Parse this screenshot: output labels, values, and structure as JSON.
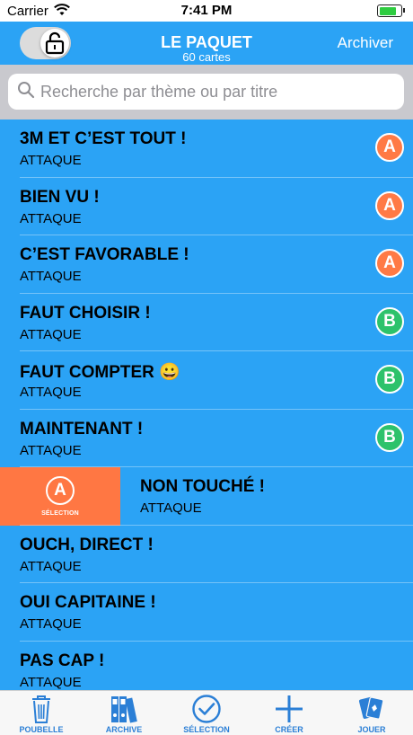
{
  "status_bar": {
    "carrier": "Carrier",
    "time": "7:41 PM",
    "battery_level": 0.85
  },
  "nav": {
    "title": "LE PAQUET",
    "subtitle": "60 cartes",
    "right_button": "Archiver",
    "lock_icon": "unlock-icon"
  },
  "search": {
    "placeholder": "Recherche par thème ou par titre",
    "value": ""
  },
  "list": {
    "rows": [
      {
        "title": "3M ET C’EST TOUT !",
        "subtitle": "ATTAQUE",
        "badge": "A"
      },
      {
        "title": "BIEN VU !",
        "subtitle": "ATTAQUE",
        "badge": "A"
      },
      {
        "title": "C’EST FAVORABLE !",
        "subtitle": "ATTAQUE",
        "badge": "A"
      },
      {
        "title": "FAUT CHOISIR !",
        "subtitle": "ATTAQUE",
        "badge": "B"
      },
      {
        "title": "FAUT COMPTER 😀",
        "subtitle": "ATTAQUE",
        "badge": "B"
      },
      {
        "title": "MAINTENANT !",
        "subtitle": "ATTAQUE",
        "badge": "B"
      },
      {
        "title": "NON TOUCHÉ !",
        "subtitle": "ATTAQUE",
        "swiped": true,
        "action_badge": "A",
        "action_label": "SÉLECTION"
      },
      {
        "title": "OUCH, DIRECT !",
        "subtitle": "ATTAQUE"
      },
      {
        "title": "OUI CAPITAINE !",
        "subtitle": "ATTAQUE"
      },
      {
        "title": "PAS CAP !",
        "subtitle": "ATTAQUE"
      }
    ]
  },
  "tabbar": {
    "tabs": [
      {
        "label": "POUBELLE",
        "icon": "trash-icon"
      },
      {
        "label": "ARCHIVE",
        "icon": "binders-icon"
      },
      {
        "label": "SÉLECTION",
        "icon": "check-circle-icon"
      },
      {
        "label": "CRÉER",
        "icon": "plus-icon"
      },
      {
        "label": "JOUER",
        "icon": "cards-icon"
      }
    ]
  },
  "colors": {
    "background": "#2ba3f5",
    "badge_a": "#ff7a45",
    "badge_b": "#2dc26b",
    "action": "#ff7743",
    "tab_tint": "#2b7fd6"
  }
}
